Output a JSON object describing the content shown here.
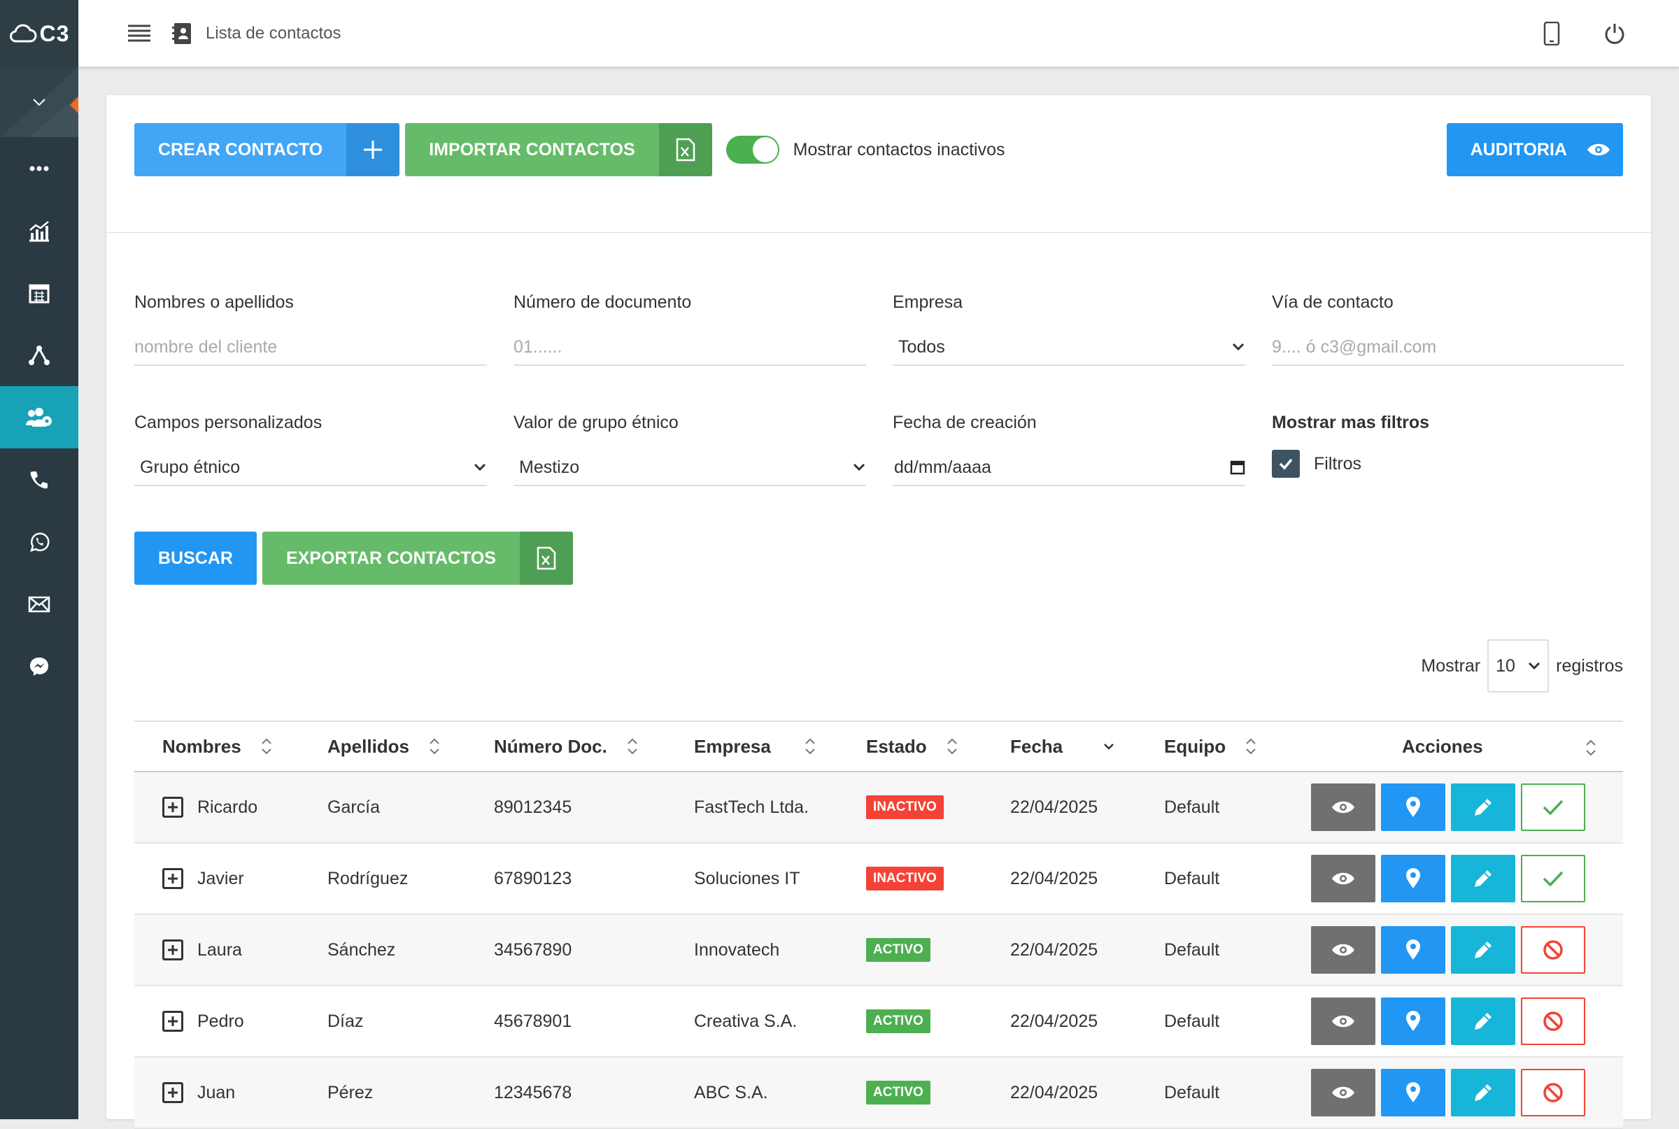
{
  "app": {
    "logo_text": "C3"
  },
  "header": {
    "breadcrumb": "Lista de contactos"
  },
  "sidebar": {
    "items": [
      {
        "icon": "more-icon"
      },
      {
        "icon": "chart-icon"
      },
      {
        "icon": "calendar-icon"
      },
      {
        "icon": "network-icon"
      },
      {
        "icon": "contacts-icon",
        "active": true
      },
      {
        "icon": "phone-icon"
      },
      {
        "icon": "whatsapp-icon"
      },
      {
        "icon": "mail-icon"
      },
      {
        "icon": "messenger-icon"
      }
    ]
  },
  "toolbar": {
    "create_label": "CREAR CONTACTO",
    "import_label": "IMPORTAR CONTACTOS",
    "toggle_label": "Mostrar contactos inactivos",
    "audit_label": "AUDITORIA"
  },
  "filters": {
    "name_label": "Nombres o apellidos",
    "name_placeholder": "nombre del cliente",
    "doc_label": "Número de documento",
    "doc_placeholder": "01......",
    "company_label": "Empresa",
    "company_value": "Todos",
    "contact_label": "Vía de contacto",
    "contact_placeholder": "9.... ó c3@gmail.com",
    "custom_label": "Campos personalizados",
    "custom_value": "Grupo étnico",
    "ethnic_label": "Valor de grupo étnico",
    "ethnic_value": "Mestizo",
    "date_label": "Fecha de creación",
    "date_placeholder": "dd/mm/aaaa",
    "more_label": "Mostrar mas filtros",
    "more_checkbox": "Filtros"
  },
  "actions": {
    "search_label": "BUSCAR",
    "export_label": "EXPORTAR CONTACTOS"
  },
  "pagination": {
    "show_label": "Mostrar",
    "page_size": "10",
    "records_label": "registros"
  },
  "table": {
    "headers": [
      "Nombres",
      "Apellidos",
      "Número Doc.",
      "Empresa",
      "Estado",
      "Fecha",
      "Equipo",
      "Acciones"
    ],
    "rows": [
      {
        "nombre": "Ricardo",
        "apellido": "García",
        "doc": "89012345",
        "empresa": "FastTech Ltda.",
        "estado": "INACTIVO",
        "fecha": "22/04/2025",
        "equipo": "Default"
      },
      {
        "nombre": "Javier",
        "apellido": "Rodríguez",
        "doc": "67890123",
        "empresa": "Soluciones IT",
        "estado": "INACTIVO",
        "fecha": "22/04/2025",
        "equipo": "Default"
      },
      {
        "nombre": "Laura",
        "apellido": "Sánchez",
        "doc": "34567890",
        "empresa": "Innovatech",
        "estado": "ACTIVO",
        "fecha": "22/04/2025",
        "equipo": "Default"
      },
      {
        "nombre": "Pedro",
        "apellido": "Díaz",
        "doc": "45678901",
        "empresa": "Creativa S.A.",
        "estado": "ACTIVO",
        "fecha": "22/04/2025",
        "equipo": "Default"
      },
      {
        "nombre": "Juan",
        "apellido": "Pérez",
        "doc": "12345678",
        "empresa": "ABC S.A.",
        "estado": "ACTIVO",
        "fecha": "22/04/2025",
        "equipo": "Default"
      }
    ]
  },
  "colors": {
    "sidebar": "#2b3a42",
    "active": "#17a2b8",
    "primary": "#2196f3",
    "success": "#4caf50",
    "danger": "#f44336"
  }
}
